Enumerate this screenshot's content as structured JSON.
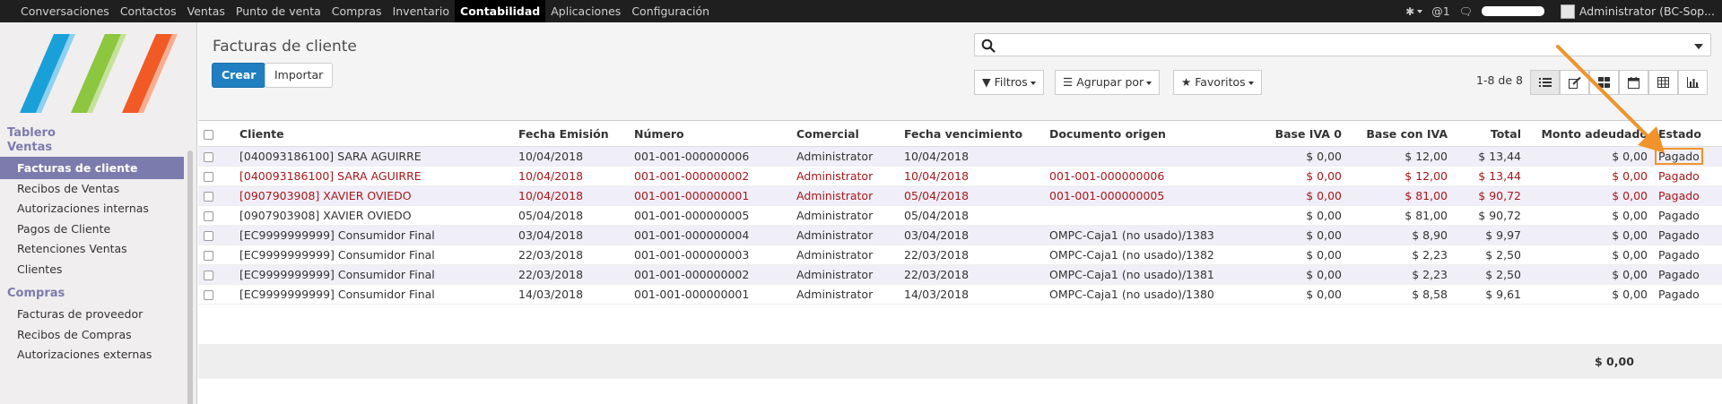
{
  "topbar": {
    "menu": [
      "Conversaciones",
      "Contactos",
      "Ventas",
      "Punto de venta",
      "Compras",
      "Inventario",
      "Contabilidad",
      "Aplicaciones",
      "Configuración"
    ],
    "active_index": 6,
    "mentions": "@1",
    "user": "Administrator (BC-Sop..."
  },
  "sidebar": {
    "sections": [
      {
        "title": "Tablero",
        "items": []
      },
      {
        "title": "Ventas",
        "items": [
          "Facturas de cliente",
          "Recibos de Ventas",
          "Autorizaciones internas",
          "Pagos de Cliente",
          "Retenciones Ventas",
          "Clientes"
        ]
      },
      {
        "title": "Compras",
        "items": [
          "Facturas de proveedor",
          "Recibos de Compras",
          "Autorizaciones externas"
        ]
      }
    ],
    "active_item": "Facturas de cliente"
  },
  "control_panel": {
    "title": "Facturas de cliente",
    "create": "Crear",
    "import": "Importar",
    "filters": "Filtros",
    "group_by": "Agrupar por",
    "favorites": "Favoritos",
    "pager": "1-8 de 8",
    "search_placeholder": ""
  },
  "table": {
    "columns": [
      "Cliente",
      "Fecha Emisión",
      "Número",
      "Comercial",
      "Fecha vencimiento",
      "Documento origen",
      "Base IVA 0",
      "Base con IVA",
      "Total",
      "Monto adeudado",
      "Estado"
    ],
    "rows": [
      {
        "cells": [
          "[040093186100] SARA AGUIRRE",
          "10/04/2018",
          "001-001-000000006",
          "Administrator",
          "10/04/2018",
          "",
          "$ 0,00",
          "$ 12,00",
          "$ 13,44",
          "$ 0,00",
          "Pagado"
        ],
        "red": false,
        "highlight": true
      },
      {
        "cells": [
          "[040093186100] SARA AGUIRRE",
          "10/04/2018",
          "001-001-000000002",
          "Administrator",
          "10/04/2018",
          "001-001-000000006",
          "$ 0,00",
          "$ 12,00",
          "$ 13,44",
          "$ 0,00",
          "Pagado"
        ],
        "red": true,
        "highlight": false
      },
      {
        "cells": [
          "[0907903908] XAVIER OVIEDO",
          "10/04/2018",
          "001-001-000000001",
          "Administrator",
          "05/04/2018",
          "001-001-000000005",
          "$ 0,00",
          "$ 81,00",
          "$ 90,72",
          "$ 0,00",
          "Pagado"
        ],
        "red": true,
        "highlight": false
      },
      {
        "cells": [
          "[0907903908] XAVIER OVIEDO",
          "05/04/2018",
          "001-001-000000005",
          "Administrator",
          "05/04/2018",
          "",
          "$ 0,00",
          "$ 81,00",
          "$ 90,72",
          "$ 0,00",
          "Pagado"
        ],
        "red": false,
        "highlight": false
      },
      {
        "cells": [
          "[EC9999999999] Consumidor Final",
          "03/04/2018",
          "001-001-000000004",
          "Administrator",
          "03/04/2018",
          "OMPC-Caja1 (no usado)/1383",
          "$ 0,00",
          "$ 8,90",
          "$ 9,97",
          "$ 0,00",
          "Pagado"
        ],
        "red": false,
        "highlight": false
      },
      {
        "cells": [
          "[EC9999999999] Consumidor Final",
          "22/03/2018",
          "001-001-000000003",
          "Administrator",
          "22/03/2018",
          "OMPC-Caja1 (no usado)/1382",
          "$ 0,00",
          "$ 2,23",
          "$ 2,50",
          "$ 0,00",
          "Pagado"
        ],
        "red": false,
        "highlight": false
      },
      {
        "cells": [
          "[EC9999999999] Consumidor Final",
          "22/03/2018",
          "001-001-000000002",
          "Administrator",
          "22/03/2018",
          "OMPC-Caja1 (no usado)/1381",
          "$ 0,00",
          "$ 2,23",
          "$ 2,50",
          "$ 0,00",
          "Pagado"
        ],
        "red": false,
        "highlight": false
      },
      {
        "cells": [
          "[EC9999999999] Consumidor Final",
          "14/03/2018",
          "001-001-000000001",
          "Administrator",
          "14/03/2018",
          "OMPC-Caja1 (no usado)/1380",
          "$ 0,00",
          "$ 8,58",
          "$ 9,61",
          "$ 0,00",
          "Pagado"
        ],
        "red": false,
        "highlight": false
      }
    ],
    "footer_total": "$ 0,00"
  },
  "colors": {
    "accent": "#7c7bad",
    "primary_button": "#1f7fc1",
    "overdue_text": "#a8171c",
    "annotation": "#f0932b"
  }
}
